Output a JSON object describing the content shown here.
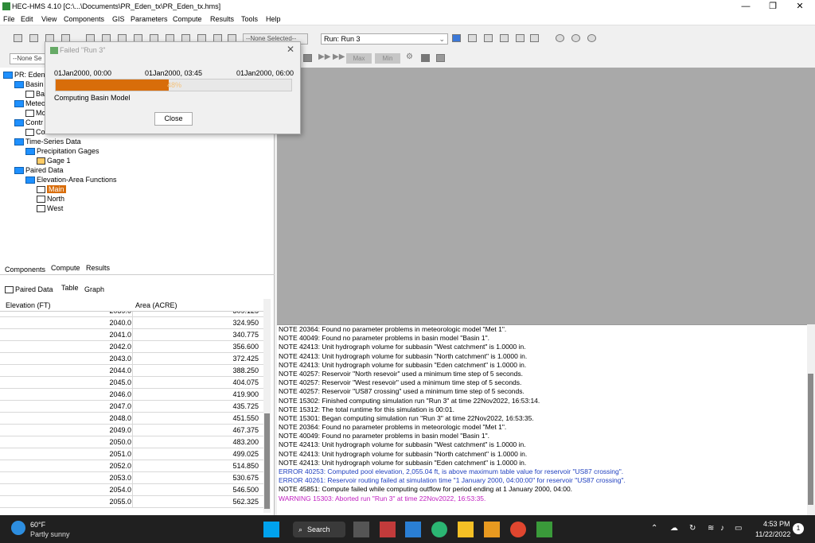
{
  "window": {
    "title": "HEC-HMS 4.10 [C:\\...\\Documents\\PR_Eden_tx\\PR_Eden_tx.hms]"
  },
  "menu": [
    "File",
    "Edit",
    "View",
    "Components",
    "GIS",
    "Parameters",
    "Compute",
    "Results",
    "Tools",
    "Help"
  ],
  "toolbar": {
    "none_selected": "--None Selected--",
    "run_select": "Run: Run 3",
    "none_selected_short": "--None Se",
    "max": "Max",
    "min": "Min"
  },
  "tree": {
    "root": "PR: Eden",
    "basin": "Basin",
    "ba": "Ba",
    "met": "Meteo",
    "mc": "Mc",
    "control": "Contr",
    "co": "Co",
    "timeseries": "Time-Series Data",
    "precip": "Precipitation Gages",
    "gage1": "Gage 1",
    "paired": "Paired Data",
    "elev_area": "Elevation-Area Functions",
    "main": "Main",
    "north": "North",
    "west": "West"
  },
  "tabs": [
    "Components",
    "Compute",
    "Results"
  ],
  "subtabs": {
    "paired": "Paired Data",
    "table": "Table",
    "graph": "Graph"
  },
  "table": {
    "headers": [
      "Elevation (FT)",
      "Area (ACRE)"
    ],
    "rows": [
      [
        "2039.0",
        "309.125"
      ],
      [
        "2040.0",
        "324.950"
      ],
      [
        "2041.0",
        "340.775"
      ],
      [
        "2042.0",
        "356.600"
      ],
      [
        "2043.0",
        "372.425"
      ],
      [
        "2044.0",
        "388.250"
      ],
      [
        "2045.0",
        "404.075"
      ],
      [
        "2046.0",
        "419.900"
      ],
      [
        "2047.0",
        "435.725"
      ],
      [
        "2048.0",
        "451.550"
      ],
      [
        "2049.0",
        "467.375"
      ],
      [
        "2050.0",
        "483.200"
      ],
      [
        "2051.0",
        "499.025"
      ],
      [
        "2052.0",
        "514.850"
      ],
      [
        "2053.0",
        "530.675"
      ],
      [
        "2054.0",
        "546.500"
      ],
      [
        "2055.0",
        "562.325"
      ]
    ]
  },
  "log": [
    {
      "text": "NOTE 20364:  Found no parameter problems in meteorologic model \"Met 1\".",
      "color": "#000000"
    },
    {
      "text": "NOTE 40049:  Found no parameter problems in basin model \"Basin 1\".",
      "color": "#000000"
    },
    {
      "text": "NOTE 42413:  Unit hydrograph volume for subbasin \"West catchment\" is 1.0000 in.",
      "color": "#000000"
    },
    {
      "text": "NOTE 42413:  Unit hydrograph volume for subbasin \"North catchment\" is 1.0000 in.",
      "color": "#000000"
    },
    {
      "text": "NOTE 42413:  Unit hydrograph volume for subbasin \"Eden catchment\" is 1.0000 in.",
      "color": "#000000"
    },
    {
      "text": "NOTE 40257:  Reservoir \"North resevoir\" used a minimum time step of 5 seconds.",
      "color": "#000000"
    },
    {
      "text": "NOTE 40257:  Reservoir \"West resevoir\" used a minimum time step of 5 seconds.",
      "color": "#000000"
    },
    {
      "text": "NOTE 40257:  Reservoir \"US87 crossing\" used a minimum time step of 5 seconds.",
      "color": "#000000"
    },
    {
      "text": "NOTE 15302:  Finished computing simulation run \"Run 3\" at time 22Nov2022, 16:53:14.",
      "color": "#000000"
    },
    {
      "text": "NOTE 15312:  The total runtime for this simulation is 00:01.",
      "color": "#000000"
    },
    {
      "text": "NOTE 15301:  Began computing simulation run \"Run 3\" at time 22Nov2022, 16:53:35.",
      "color": "#000000"
    },
    {
      "text": "NOTE 20364:  Found no parameter problems in meteorologic model \"Met 1\".",
      "color": "#000000"
    },
    {
      "text": "NOTE 40049:  Found no parameter problems in basin model \"Basin 1\".",
      "color": "#000000"
    },
    {
      "text": "NOTE 42413:  Unit hydrograph volume for subbasin \"West catchment\" is 1.0000 in.",
      "color": "#000000"
    },
    {
      "text": "NOTE 42413:  Unit hydrograph volume for subbasin \"North catchment\" is 1.0000 in.",
      "color": "#000000"
    },
    {
      "text": "NOTE 42413:  Unit hydrograph volume for subbasin \"Eden catchment\" is 1.0000 in.",
      "color": "#000000"
    },
    {
      "text": "ERROR 40253:  Computed pool elevation, 2,055.04 ft, is above maximum table value for reservoir \"US87 crossing\".",
      "color": "#1f3fbf"
    },
    {
      "text": "ERROR 40261:  Reservoir routing failed at simulation time \"1 January 2000, 04:00:00\" for reservoir \"US87 crossing\".",
      "color": "#1f3fbf"
    },
    {
      "text": "NOTE 45851:  Compute failed while computing outflow for period ending at 1 January 2000, 04:00.",
      "color": "#000000"
    },
    {
      "text": "WARNING 15303:  Aborted run \"Run 3\" at time 22Nov2022, 16:53:35.",
      "color": "#c020c0"
    }
  ],
  "dialog": {
    "title": "Failed \"Run 3\"",
    "start": "01Jan2000, 00:00",
    "mid": "01Jan2000, 03:45",
    "end": "01Jan2000, 06:00",
    "progress_text": "48%",
    "progress_fraction": 0.48,
    "status": "Computing Basin Model",
    "close_label": "Close"
  },
  "taskbar": {
    "temp": "60°F",
    "weather": "Partly sunny",
    "search": "Search",
    "time": "4:53 PM",
    "date": "11/22/2022"
  }
}
